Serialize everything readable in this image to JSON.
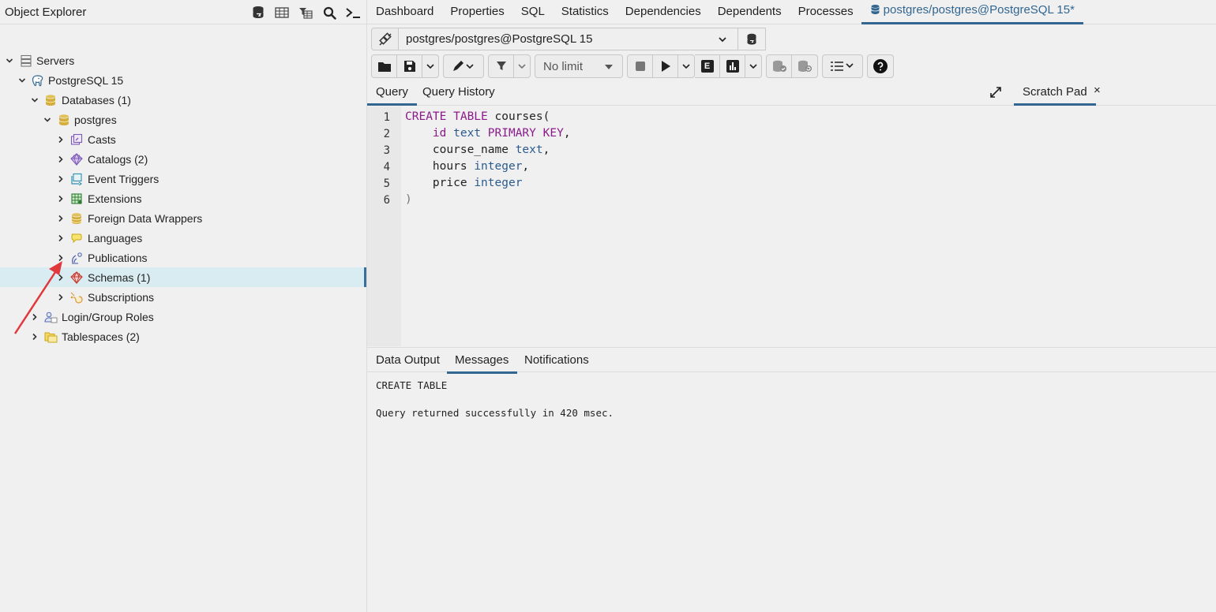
{
  "left": {
    "title": "Object Explorer",
    "tools": [
      "database-icon",
      "table-icon",
      "filter-table-icon",
      "search-icon",
      "terminal-icon"
    ],
    "tree": [
      {
        "label": "Servers",
        "icon": "servers-icon"
      },
      {
        "label": "PostgreSQL 15",
        "icon": "postgres-elephant-icon"
      },
      {
        "label": "Databases (1)",
        "icon": "databases-icon"
      },
      {
        "label": "postgres",
        "icon": "database-icon"
      },
      {
        "label": "Casts",
        "icon": "casts-icon"
      },
      {
        "label": "Catalogs (2)",
        "icon": "catalogs-icon"
      },
      {
        "label": "Event Triggers",
        "icon": "event-triggers-icon"
      },
      {
        "label": "Extensions",
        "icon": "extensions-icon"
      },
      {
        "label": "Foreign Data Wrappers",
        "icon": "foreign-data-wrappers-icon"
      },
      {
        "label": "Languages",
        "icon": "languages-icon"
      },
      {
        "label": "Publications",
        "icon": "publications-icon"
      },
      {
        "label": "Schemas (1)",
        "icon": "schemas-icon"
      },
      {
        "label": "Subscriptions",
        "icon": "subscriptions-icon"
      },
      {
        "label": "Login/Group Roles",
        "icon": "roles-icon"
      },
      {
        "label": "Tablespaces (2)",
        "icon": "tablespaces-icon"
      }
    ]
  },
  "tabs": [
    {
      "label": "Dashboard"
    },
    {
      "label": "Properties"
    },
    {
      "label": "SQL"
    },
    {
      "label": "Statistics"
    },
    {
      "label": "Dependencies"
    },
    {
      "label": "Dependents"
    },
    {
      "label": "Processes"
    },
    {
      "label": "postgres/postgres@PostgreSQL 15*"
    }
  ],
  "connection": {
    "value": "postgres/postgres@PostgreSQL 15"
  },
  "toolbar": {
    "limit": "No limit",
    "explain": "E"
  },
  "editor_tabs": {
    "query": "Query",
    "history": "Query History",
    "scratch": "Scratch Pad",
    "close": "×"
  },
  "code": {
    "lines": [
      "1",
      "2",
      "3",
      "4",
      "5",
      "6"
    ]
  },
  "output": {
    "tabs": [
      "Data Output",
      "Messages",
      "Notifications"
    ],
    "line1": "CREATE TABLE",
    "line2": "Query returned successfully in 420 msec."
  },
  "colors": {
    "accent": "#326690",
    "keyword": "#8b1a8b",
    "type": "#2b5b8e",
    "annotation_arrow": "#e0383c"
  }
}
